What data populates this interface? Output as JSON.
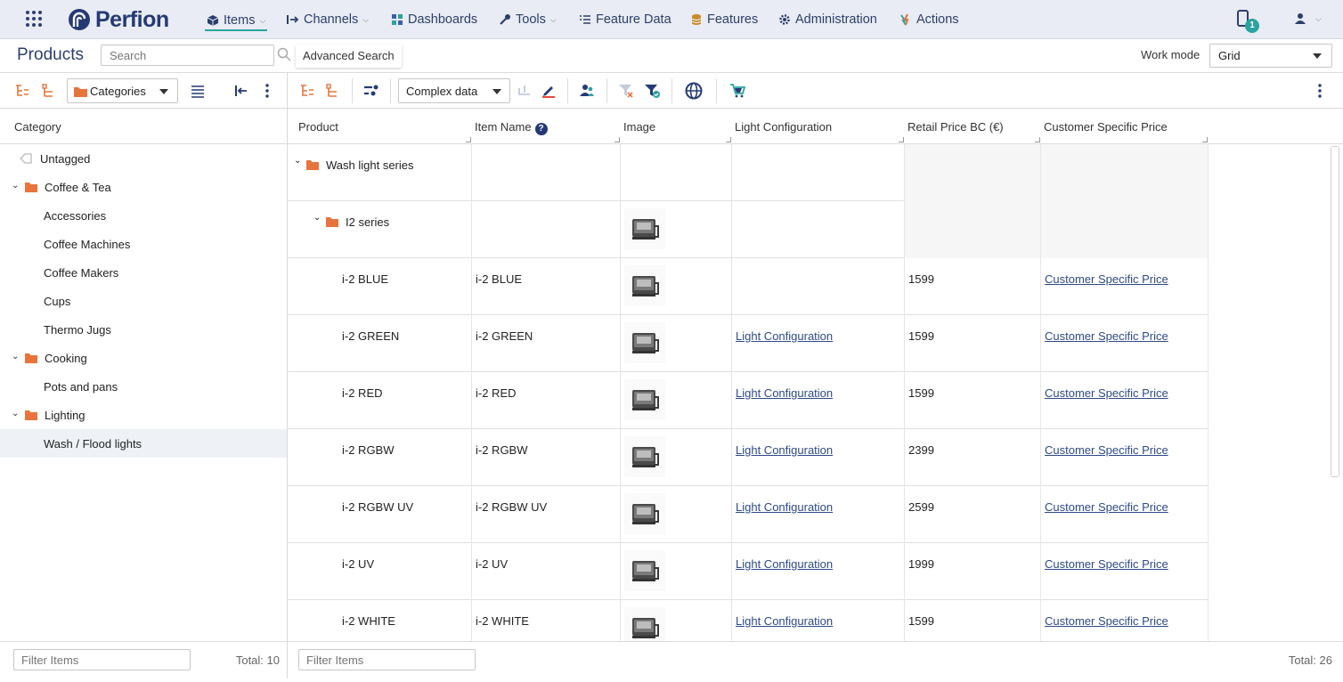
{
  "app": {
    "brand": "Perfion"
  },
  "nav": [
    {
      "label": "Items",
      "icon": "cube-icon"
    },
    {
      "label": "Channels",
      "icon": "channels-icon"
    },
    {
      "label": "Dashboards",
      "icon": "dashboard-icon"
    },
    {
      "label": "Tools",
      "icon": "wrench-icon"
    },
    {
      "label": "Feature Data",
      "icon": "list-icon"
    },
    {
      "label": "Features",
      "icon": "database-icon"
    },
    {
      "label": "Administration",
      "icon": "gear-icon"
    },
    {
      "label": "Actions",
      "icon": "lightning-icon"
    }
  ],
  "notifications": {
    "count": "1"
  },
  "page": {
    "title": "Products",
    "search_placeholder": "Search",
    "advanced_search": "Advanced Search",
    "work_mode_label": "Work mode",
    "work_mode_value": "Grid"
  },
  "left": {
    "dropdown": "Categories",
    "column": "Category",
    "items": [
      {
        "label": "Untagged"
      },
      {
        "label": "Coffee & Tea"
      },
      {
        "label": "Accessories"
      },
      {
        "label": "Coffee Machines"
      },
      {
        "label": "Coffee Makers"
      },
      {
        "label": "Cups"
      },
      {
        "label": "Thermo Jugs"
      },
      {
        "label": "Cooking"
      },
      {
        "label": "Pots and pans"
      },
      {
        "label": "Lighting"
      },
      {
        "label": "Wash / Flood lights"
      }
    ],
    "filter_placeholder": "Filter Items",
    "total": "Total: 10"
  },
  "grid": {
    "view_dropdown": "Complex data",
    "columns": {
      "product": "Product",
      "item_name": "Item Name",
      "image": "Image",
      "light_config": "Light Configuration",
      "retail_price": "Retail Price BC (€)",
      "customer_price": "Customer Specific Price"
    },
    "help_glyph": "?",
    "rows": [
      {
        "product": "Wash light series",
        "item_name": "",
        "light_config": "",
        "price": "",
        "customer": ""
      },
      {
        "product": "I2 series",
        "item_name": "",
        "light_config": "",
        "price": "",
        "customer": ""
      },
      {
        "product": "i-2 BLUE",
        "item_name": "i-2 BLUE",
        "light_config": "",
        "price": "1599",
        "customer": "Customer Specific Price"
      },
      {
        "product": "i-2 GREEN",
        "item_name": "i-2 GREEN",
        "light_config": "Light Configuration",
        "price": "1599",
        "customer": "Customer Specific Price"
      },
      {
        "product": "i-2 RED",
        "item_name": "i-2 RED",
        "light_config": "Light Configuration",
        "price": "1599",
        "customer": "Customer Specific Price"
      },
      {
        "product": "i-2 RGBW",
        "item_name": "i-2 RGBW",
        "light_config": "Light Configuration",
        "price": "2399",
        "customer": "Customer Specific Price"
      },
      {
        "product": "i-2 RGBW UV",
        "item_name": "i-2 RGBW UV",
        "light_config": "Light Configuration",
        "price": "2599",
        "customer": "Customer Specific Price"
      },
      {
        "product": "i-2 UV",
        "item_name": "i-2 UV",
        "light_config": "Light Configuration",
        "price": "1999",
        "customer": "Customer Specific Price"
      },
      {
        "product": "i-2 WHITE",
        "item_name": "i-2 WHITE",
        "light_config": "Light Configuration",
        "price": "1599",
        "customer": "Customer Specific Price"
      }
    ],
    "filter_placeholder": "Filter Items",
    "total": "Total: 26"
  },
  "colors": {
    "brand": "#253a74",
    "accent": "#2aa3a0",
    "folder": "#e8743b"
  }
}
